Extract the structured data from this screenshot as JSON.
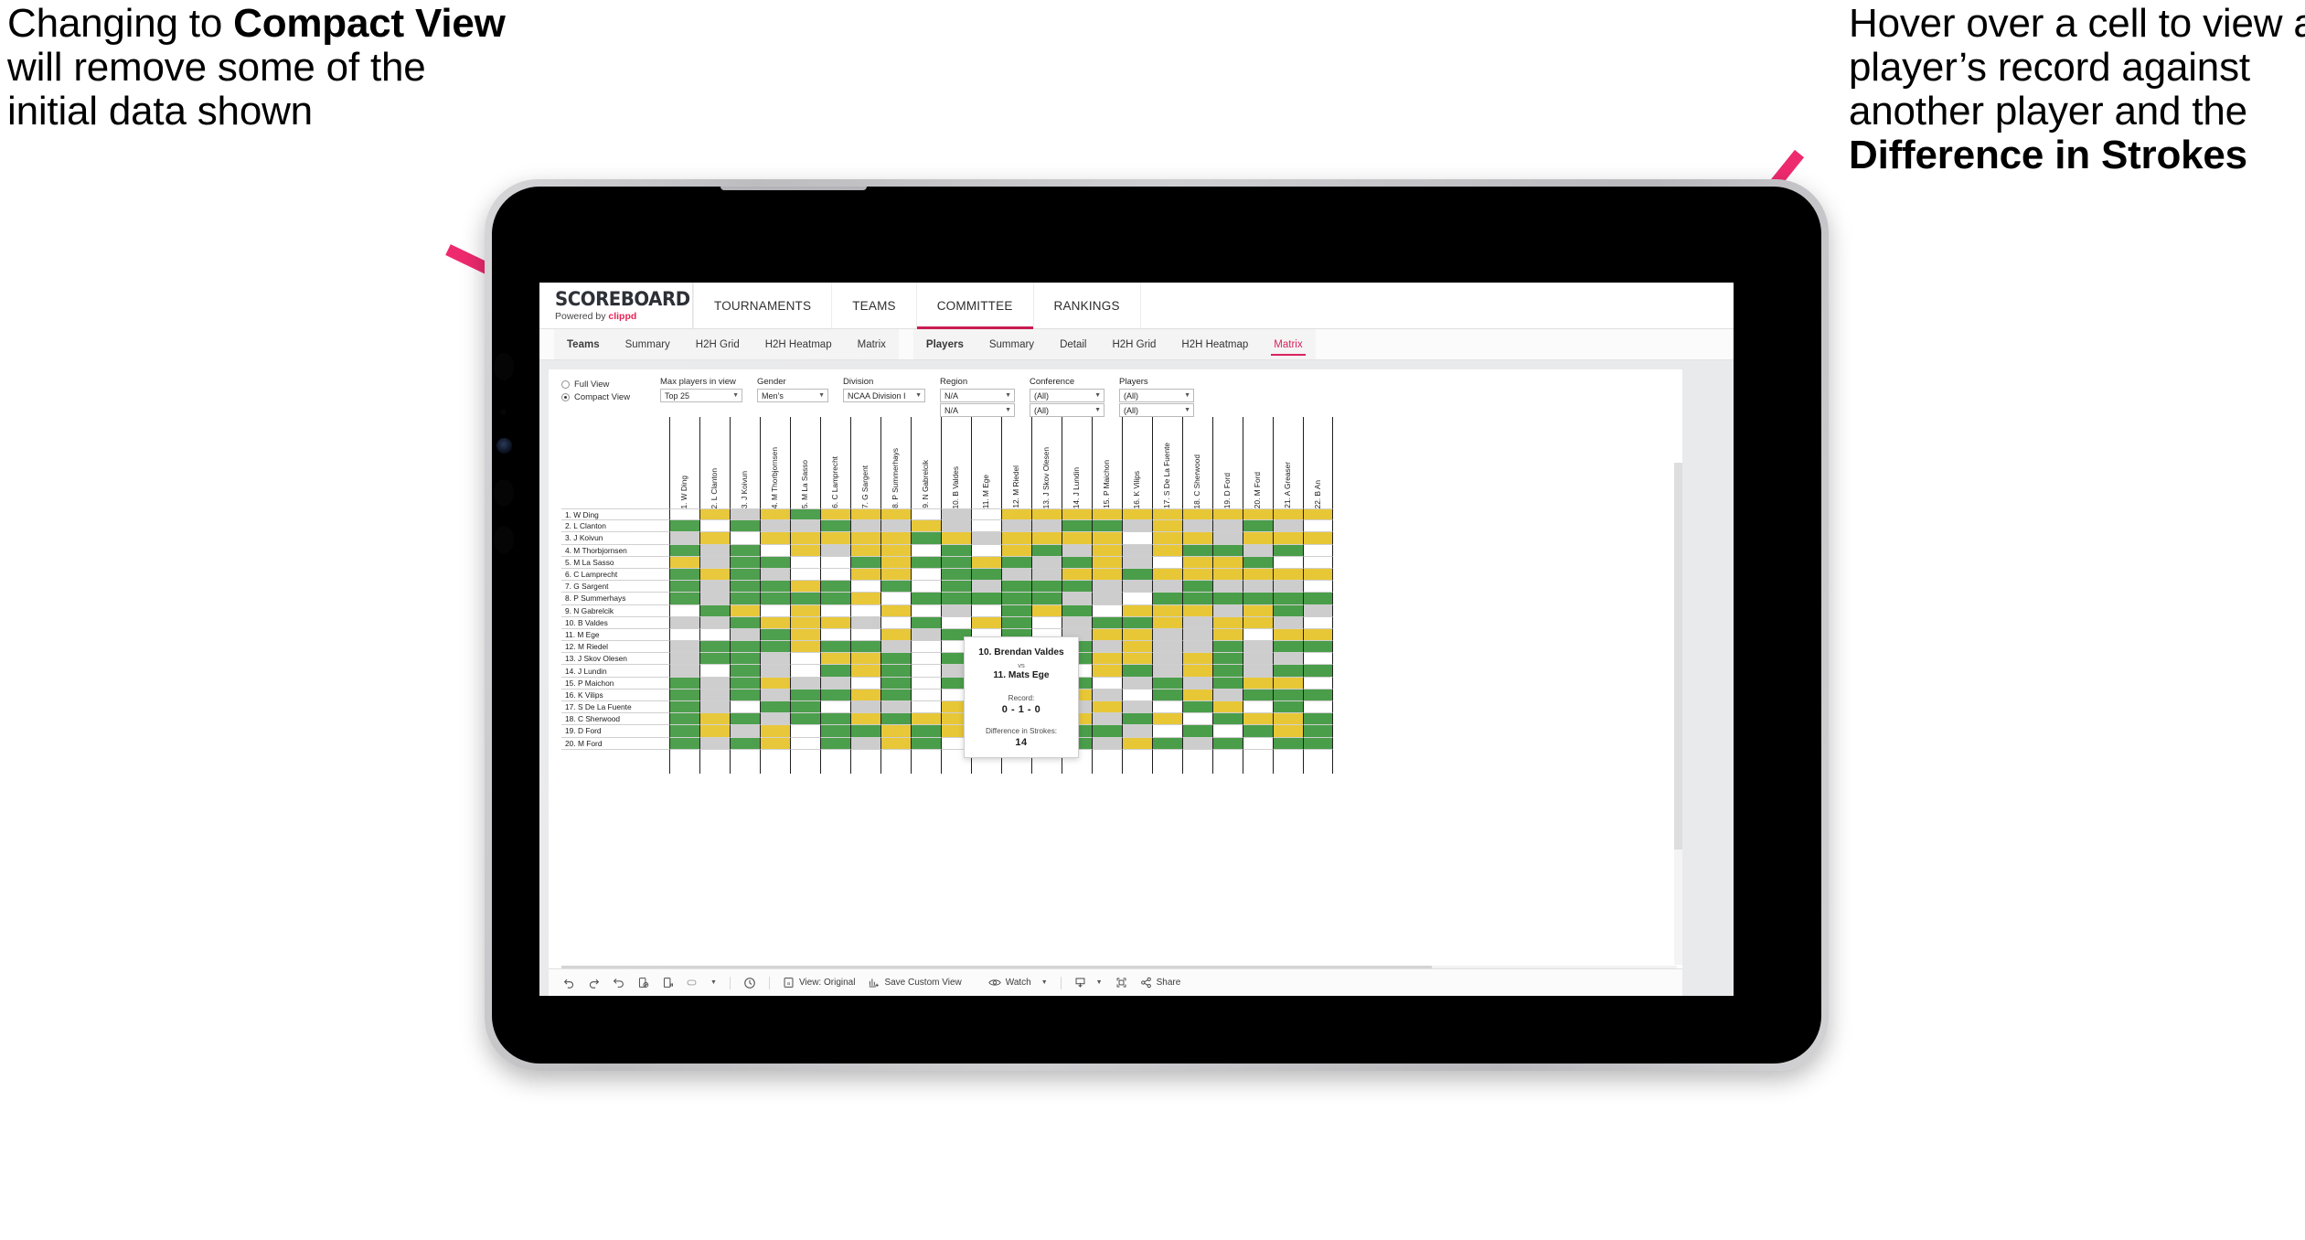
{
  "annotations": {
    "left": {
      "part1": "Changing to ",
      "bold": "Compact View",
      "part2": " will remove some of the initial data shown"
    },
    "right": {
      "part1": "Hover over a cell to view a player’s record against another player and the ",
      "bold": "Difference in Strokes"
    },
    "arrow_color": "#ee2a6e"
  },
  "app": {
    "brand": {
      "wordmark": "SCOREBOARD",
      "powered_prefix": "Powered by ",
      "powered_brand": "clippd"
    },
    "top_nav": [
      {
        "label": "TOURNAMENTS",
        "active": false
      },
      {
        "label": "TEAMS",
        "active": false
      },
      {
        "label": "COMMITTEE",
        "active": true
      },
      {
        "label": "RANKINGS",
        "active": false
      }
    ],
    "sub_nav_group_1": [
      {
        "label": "Teams",
        "bold": true,
        "active": false
      },
      {
        "label": "Summary",
        "bold": false,
        "active": false
      },
      {
        "label": "H2H Grid",
        "bold": false,
        "active": false
      },
      {
        "label": "H2H Heatmap",
        "bold": false,
        "active": false
      },
      {
        "label": "Matrix",
        "bold": false,
        "active": false
      }
    ],
    "sub_nav_group_2": [
      {
        "label": "Players",
        "bold": true,
        "active": false
      },
      {
        "label": "Summary",
        "bold": false,
        "active": false
      },
      {
        "label": "Detail",
        "bold": false,
        "active": false
      },
      {
        "label": "H2H Grid",
        "bold": false,
        "active": false
      },
      {
        "label": "H2H Heatmap",
        "bold": false,
        "active": false
      },
      {
        "label": "Matrix",
        "bold": false,
        "active": true
      }
    ],
    "accent_color": "#c8194e",
    "tab_active_color": "#d8245c"
  },
  "filters": {
    "view_mode": {
      "full_label": "Full View",
      "compact_label": "Compact View",
      "selected": "Compact View"
    },
    "max_players": {
      "label": "Max players in view",
      "value": "Top 25"
    },
    "gender": {
      "label": "Gender",
      "value": "Men’s"
    },
    "division": {
      "label": "Division",
      "value": "NCAA Division I"
    },
    "region": {
      "label": "Region",
      "value": "N/A",
      "value2": "N/A"
    },
    "conference": {
      "label": "Conference",
      "value": "(All)",
      "value2": "(All)"
    },
    "players": {
      "label": "Players",
      "value": "(All)",
      "value2": "(All)"
    }
  },
  "matrix": {
    "columns": [
      "1. W Ding",
      "2. L Clanton",
      "3. J Koivun",
      "4. M Thorbjornsen",
      "5. M La Sasso",
      "6. C Lamprecht",
      "7. G Sargent",
      "8. P Summerhays",
      "9. N Gabrelcik",
      "10. B Valdes",
      "11. M Ege",
      "12. M Riedel",
      "13. J Skov Olesen",
      "14. J Lundin",
      "15. P Maichon",
      "16. K Vilips",
      "17. S De La Fuente",
      "18. C Sherwood",
      "19. D Ford",
      "20. M Ford",
      "21. A Greaser",
      "22. B An"
    ],
    "rows": [
      "1. W Ding",
      "2. L Clanton",
      "3. J Koivun",
      "4. M Thorbjornsen",
      "5. M La Sasso",
      "6. C Lamprecht",
      "7. G Sargent",
      "8. P Summerhays",
      "9. N Gabrelcik",
      "10. B Valdes",
      "11. M Ege",
      "12. M Riedel",
      "13. J Skov Olesen",
      "14. J Lundin",
      "15. P Maichon",
      "16. K Vilips",
      "17. S De La Fuente",
      "18. C Sherwood",
      "19. D Ford",
      "20. M Ford"
    ],
    "legend_colors": {
      "win": "#4a9e4a",
      "tie": "#e8c737",
      "loss": "#cdcdcd",
      "none": "#ffffff"
    },
    "cells": [
      [
        "w",
        "y",
        "s",
        "y",
        "g",
        "y",
        "y",
        "y",
        "w",
        "s",
        "w",
        "y",
        "y",
        "y",
        "y",
        "y",
        "y",
        "y",
        "y",
        "y",
        "y",
        "y"
      ],
      [
        "g",
        "w",
        "g",
        "s",
        "s",
        "g",
        "s",
        "s",
        "y",
        "s",
        "w",
        "s",
        "s",
        "g",
        "g",
        "s",
        "y",
        "s",
        "s",
        "g",
        "s",
        "w"
      ],
      [
        "s",
        "y",
        "w",
        "y",
        "y",
        "y",
        "y",
        "y",
        "g",
        "y",
        "s",
        "y",
        "y",
        "y",
        "y",
        "w",
        "y",
        "y",
        "s",
        "y",
        "y",
        "y"
      ],
      [
        "g",
        "s",
        "g",
        "w",
        "y",
        "s",
        "y",
        "y",
        "w",
        "g",
        "w",
        "y",
        "g",
        "s",
        "y",
        "s",
        "y",
        "g",
        "g",
        "s",
        "g",
        "w"
      ],
      [
        "y",
        "s",
        "g",
        "g",
        "w",
        "w",
        "g",
        "y",
        "g",
        "g",
        "y",
        "g",
        "s",
        "g",
        "y",
        "s",
        "w",
        "y",
        "y",
        "g",
        "w",
        "w"
      ],
      [
        "g",
        "y",
        "g",
        "s",
        "w",
        "w",
        "y",
        "y",
        "w",
        "g",
        "g",
        "s",
        "s",
        "y",
        "y",
        "g",
        "y",
        "y",
        "y",
        "y",
        "y",
        "y"
      ],
      [
        "g",
        "s",
        "g",
        "g",
        "y",
        "g",
        "w",
        "g",
        "w",
        "g",
        "s",
        "g",
        "g",
        "g",
        "s",
        "s",
        "s",
        "g",
        "s",
        "s",
        "s",
        "w"
      ],
      [
        "g",
        "s",
        "g",
        "g",
        "g",
        "g",
        "y",
        "w",
        "g",
        "g",
        "g",
        "g",
        "g",
        "s",
        "s",
        "w",
        "g",
        "g",
        "g",
        "g",
        "g",
        "g"
      ],
      [
        "w",
        "g",
        "y",
        "w",
        "y",
        "w",
        "w",
        "y",
        "w",
        "s",
        "w",
        "g",
        "y",
        "g",
        "w",
        "y",
        "y",
        "y",
        "s",
        "y",
        "g",
        "s"
      ],
      [
        "s",
        "s",
        "g",
        "y",
        "y",
        "y",
        "s",
        "w",
        "g",
        "w",
        "y",
        "g",
        "w",
        "s",
        "g",
        "g",
        "y",
        "s",
        "y",
        "y",
        "s",
        "w"
      ],
      [
        "w",
        "w",
        "s",
        "g",
        "y",
        "w",
        "w",
        "y",
        "s",
        "g",
        "w",
        "g",
        "w",
        "s",
        "y",
        "y",
        "s",
        "s",
        "y",
        "w",
        "y",
        "y"
      ],
      [
        "s",
        "g",
        "g",
        "g",
        "y",
        "g",
        "g",
        "s",
        "w",
        "w",
        "g",
        "w",
        "y",
        "g",
        "s",
        "y",
        "s",
        "s",
        "g",
        "s",
        "g",
        "g"
      ],
      [
        "s",
        "g",
        "g",
        "s",
        "w",
        "y",
        "y",
        "g",
        "w",
        "g",
        "y",
        "s",
        "w",
        "g",
        "y",
        "y",
        "s",
        "y",
        "g",
        "s",
        "s",
        "w"
      ],
      [
        "s",
        "w",
        "g",
        "s",
        "w",
        "g",
        "y",
        "g",
        "w",
        "s",
        "y",
        "g",
        "g",
        "w",
        "y",
        "g",
        "s",
        "y",
        "g",
        "s",
        "g",
        "g"
      ],
      [
        "g",
        "s",
        "g",
        "y",
        "s",
        "s",
        "w",
        "g",
        "w",
        "g",
        "w",
        "g",
        "y",
        "g",
        "w",
        "s",
        "g",
        "s",
        "g",
        "y",
        "y",
        "w"
      ],
      [
        "g",
        "s",
        "g",
        "s",
        "g",
        "g",
        "y",
        "g",
        "w",
        "w",
        "g",
        "y",
        "s",
        "y",
        "s",
        "w",
        "g",
        "y",
        "s",
        "g",
        "g",
        "g"
      ],
      [
        "g",
        "s",
        "w",
        "g",
        "g",
        "w",
        "s",
        "s",
        "w",
        "y",
        "g",
        "s",
        "g",
        "s",
        "y",
        "s",
        "w",
        "g",
        "y",
        "w",
        "g",
        "w"
      ],
      [
        "g",
        "y",
        "g",
        "s",
        "g",
        "g",
        "y",
        "g",
        "y",
        "y",
        "y",
        "g",
        "s",
        "y",
        "s",
        "g",
        "y",
        "w",
        "g",
        "y",
        "y",
        "g"
      ],
      [
        "g",
        "y",
        "s",
        "y",
        "w",
        "g",
        "g",
        "y",
        "g",
        "y",
        "g",
        "s",
        "y",
        "g",
        "g",
        "s",
        "w",
        "g",
        "w",
        "g",
        "y",
        "g"
      ],
      [
        "g",
        "s",
        "g",
        "y",
        "w",
        "g",
        "s",
        "y",
        "g",
        "w",
        "g",
        "y",
        "g",
        "g",
        "s",
        "y",
        "g",
        "s",
        "g",
        "w",
        "g",
        "g"
      ]
    ]
  },
  "tooltip": {
    "player_a": "10. Brendan Valdes",
    "vs": "vs",
    "player_b": "11. Mats Ege",
    "record_label": "Record:",
    "record_value": "0 - 1 - 0",
    "diff_label": "Difference in Strokes:",
    "diff_value": "14"
  },
  "bottom_bar": {
    "items": [
      {
        "name": "undo",
        "label": ""
      },
      {
        "name": "redo",
        "label": ""
      },
      {
        "name": "revert",
        "label": ""
      },
      {
        "name": "refresh-data",
        "label": ""
      },
      {
        "name": "pause-auto-update",
        "label": ""
      },
      {
        "name": "device-layout",
        "label": ""
      },
      {
        "name": "history",
        "label": ""
      },
      {
        "name": "view-original",
        "label": "View: Original"
      },
      {
        "name": "save-custom-view",
        "label": "Save Custom View"
      },
      {
        "name": "watch",
        "label": "Watch"
      },
      {
        "name": "download",
        "label": ""
      },
      {
        "name": "fullscreen",
        "label": ""
      },
      {
        "name": "share",
        "label": "Share"
      }
    ]
  }
}
